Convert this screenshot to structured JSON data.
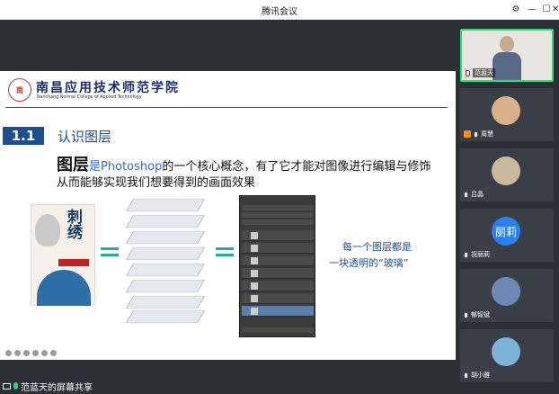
{
  "window": {
    "title": "腾讯会议",
    "controls": [
      "settings-icon",
      "minimize-icon",
      "maximize-icon",
      "close-icon"
    ]
  },
  "slide": {
    "logo_cn": "南昌应用技术师范学院",
    "logo_en": "Nanchang Normal College of Applied Technology",
    "logo_mark": "南",
    "section_number": "1.1",
    "section_title": "认识图层",
    "line1_big": "图层",
    "line1_a": "是",
    "line1_blue": "Photoshop",
    "line1_b": "的一个核心概念，有了它才能对图像进行编辑与修饰",
    "line2": "从而能够实现我们想要得到的画面效果",
    "poster_word": "刺绣",
    "caption1": "每一个图层都是",
    "caption2": "一块透明的“玻璃”",
    "colors": {
      "accent": "#1f4e8c",
      "teal": "#2aa8a0",
      "blue_text": "#2e6fd1"
    }
  },
  "share_bar": {
    "label": "范蓝天的屏幕共享"
  },
  "participants": [
    {
      "name": "范蓝天",
      "avatar": "video",
      "active": true
    },
    {
      "name": "周慧",
      "avatar": "bear-avatar"
    },
    {
      "name": "吕晶",
      "avatar": "photo-avatar"
    },
    {
      "name": "祝丽莉",
      "avatar_text": "丽莉"
    },
    {
      "name": "郁智斌",
      "avatar": "photo-avatar"
    },
    {
      "name": "胡小雅",
      "avatar": "photo-avatar"
    }
  ]
}
